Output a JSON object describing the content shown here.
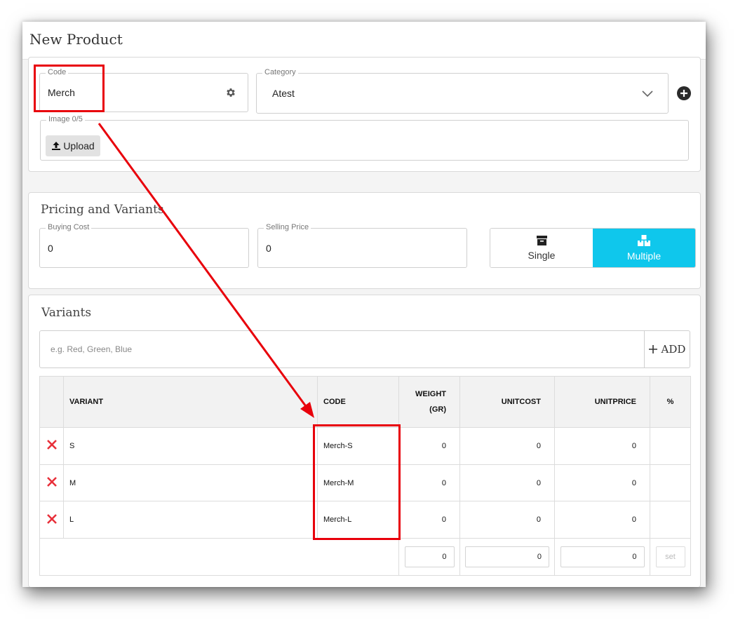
{
  "page_title": "New Product",
  "code_field": {
    "label": "Code",
    "value": "Merch"
  },
  "category_field": {
    "label": "Category",
    "value": "Atest"
  },
  "image_field": {
    "label": "Image 0/5",
    "upload_label": "Upload"
  },
  "pricing": {
    "title": "Pricing and Variants",
    "buying_cost": {
      "label": "Buying Cost",
      "value": "0"
    },
    "selling_price": {
      "label": "Selling Price",
      "value": "0"
    },
    "toggle": {
      "single": "Single",
      "multiple": "Multiple",
      "selected": "Multiple"
    }
  },
  "variants": {
    "title": "Variants",
    "input_placeholder": "e.g. Red, Green, Blue",
    "add_label": "ADD",
    "headers": {
      "variant": "VARIANT",
      "code": "CODE",
      "weight_line1": "WEIGHT",
      "weight_line2": "(GR)",
      "unitcost": "UNITCOST",
      "unitprice": "UNITPRICE",
      "percent": "%"
    },
    "rows": [
      {
        "variant": "S",
        "code": "Merch-S",
        "weight": "0",
        "unitcost": "0",
        "unitprice": "0"
      },
      {
        "variant": "M",
        "code": "Merch-M",
        "weight": "0",
        "unitcost": "0",
        "unitprice": "0"
      },
      {
        "variant": "L",
        "code": "Merch-L",
        "weight": "0",
        "unitcost": "0",
        "unitprice": "0"
      }
    ],
    "footer": {
      "weight": "0",
      "unitcost": "0",
      "unitprice": "0",
      "set_label": "set"
    }
  },
  "colors": {
    "accent": "#0fc7ec",
    "annotation": "#e8000b",
    "delete": "#e8303a"
  },
  "icons": {
    "code_settings": "gear-icon",
    "category_add": "plus-circle-icon",
    "upload": "upload-icon",
    "single": "archive-box-icon",
    "multiple": "boxes-icon",
    "add": "plus-icon",
    "delete": "close-x-icon",
    "category_dropdown": "chevron-down-icon"
  }
}
